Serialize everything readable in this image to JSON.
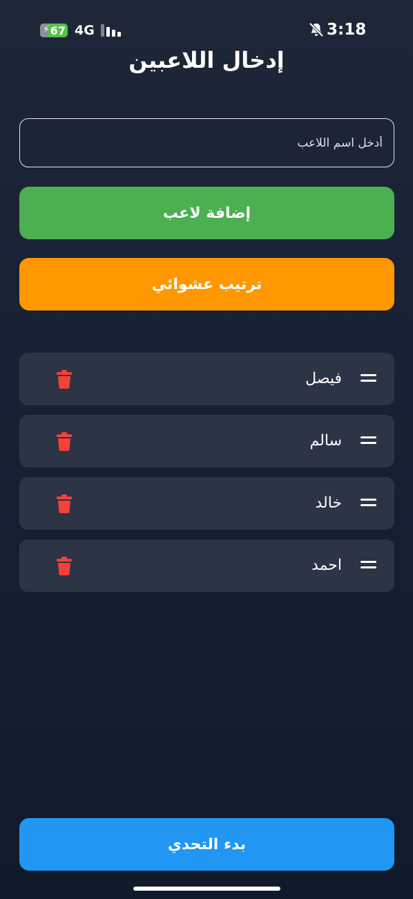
{
  "status_bar": {
    "battery_level": "67",
    "network": "4G",
    "time": "3:18",
    "icons": [
      "battery-charging-icon",
      "cellular-signal-icon",
      "silent-mode-icon"
    ]
  },
  "header": {
    "title": "إدخال اللاعبين"
  },
  "form": {
    "input_placeholder": "أدخل اسم اللاعب",
    "input_value": "",
    "add_button_label": "إضافة لاعب",
    "shuffle_button_label": "ترتيب عشوائي"
  },
  "players": [
    {
      "name": "فيصل",
      "handle_icon": "drag-handle-icon",
      "delete_icon": "trash-icon"
    },
    {
      "name": "سالم",
      "handle_icon": "drag-handle-icon",
      "delete_icon": "trash-icon"
    },
    {
      "name": "خالد",
      "handle_icon": "drag-handle-icon",
      "delete_icon": "trash-icon"
    },
    {
      "name": "احمد",
      "handle_icon": "drag-handle-icon",
      "delete_icon": "trash-icon"
    }
  ],
  "footer": {
    "start_button_label": "بدء التحدي"
  },
  "colors": {
    "background": "#1b2335",
    "add_button": "#4caf50",
    "shuffle_button": "#ff9800",
    "start_button": "#2196f3",
    "card": "#2c3446",
    "delete": "#f44336"
  }
}
